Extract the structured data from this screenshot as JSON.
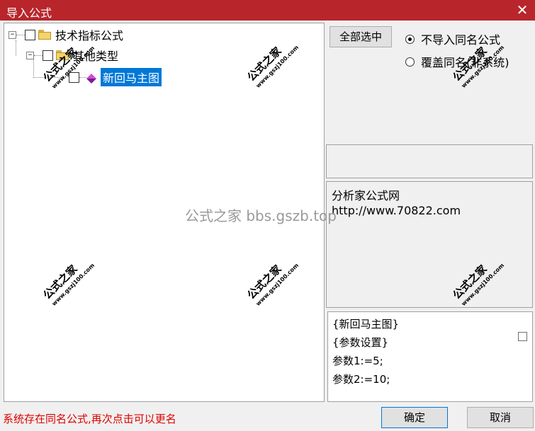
{
  "window": {
    "title": "导入公式",
    "close_glyph": "✕"
  },
  "tree": {
    "root": {
      "label": "技术指标公式",
      "expander": "−",
      "icon": "folder-icon"
    },
    "child": {
      "label": "其他类型",
      "expander": "−",
      "icon": "folder-icon"
    },
    "leaf": {
      "label": "新回马主图",
      "icon": "gem-icon",
      "selected": true
    }
  },
  "options": {
    "select_all_label": "全部选中",
    "radio_no_import": "不导入同名公式",
    "radio_overwrite": "覆盖同名(非系统)",
    "selected_radio": "no_import"
  },
  "info": {
    "line1": "分析家公式网",
    "line2": "http://www.70822.com"
  },
  "code": {
    "lines": [
      "{新回马主图}",
      "{参数设置}",
      "参数1:=5;",
      "参数2:=10;"
    ]
  },
  "status": {
    "message": "系统存在同名公式,再次点击可以更名"
  },
  "buttons": {
    "ok": "确定",
    "cancel": "取消"
  },
  "watermarks": {
    "stamp_big": "公式之家",
    "stamp_small": "www.gszj100.com",
    "center": "公式之家 bbs.gszb.top"
  },
  "colors": {
    "titlebar": "#b8262b",
    "selection": "#0078d7",
    "status": "#e00000"
  }
}
